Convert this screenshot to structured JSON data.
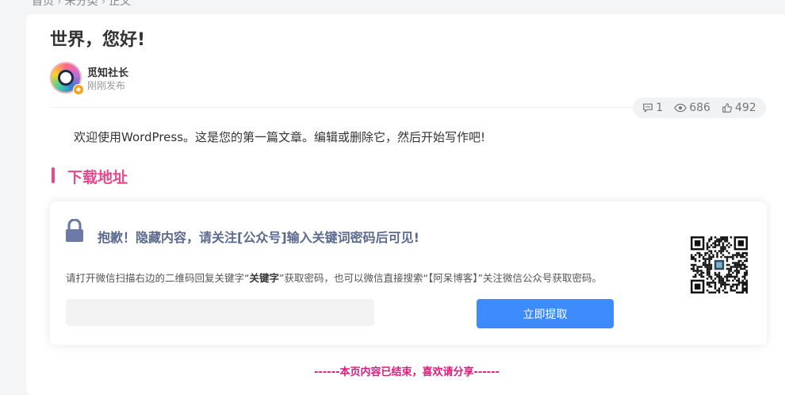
{
  "breadcrumb": {
    "home": "首页",
    "category": "未分类",
    "current": "正文"
  },
  "post": {
    "title": "世界，您好!",
    "author": "觅知社长",
    "time": "刚刚发布",
    "stats": {
      "comments": "1",
      "views": "686",
      "likes": "492"
    },
    "intro": "欢迎使用WordPress。这是您的第一篇文章。编辑或删除它，然后开始写作吧!"
  },
  "download": {
    "heading": "下载地址",
    "hidden_title": "抱歉！隐藏内容，请关注[公众号]输入关键词密码后可见!",
    "hint_pre": "请打开微信扫描右边的二维码回复关键字“",
    "hint_key": "关键字",
    "hint_post": "”获取密码，也可以微信直接搜索“【阿呆博客】”关注微信公众号获取密码。",
    "input_placeholder": "",
    "button_label": "立即提取"
  },
  "end_note": "------本页内容已结束，喜欢请分享------",
  "colors": {
    "accent_pink": "#e8488e",
    "button_blue": "#3d8bfd",
    "end_note": "#e0197d",
    "lock": "#6b7ba6"
  },
  "icons": {
    "comment": "comment-icon",
    "views": "eye-icon",
    "likes": "thumbs-up-icon",
    "lock": "lock-icon",
    "qr": "qr-code-icon"
  }
}
